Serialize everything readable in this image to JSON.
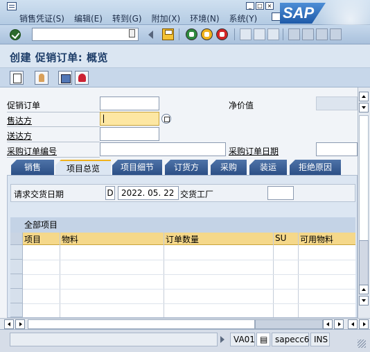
{
  "menu": {
    "items": [
      "销售凭证(S)",
      "编辑(E)",
      "转到(G)",
      "附加(X)",
      "环境(N)",
      "系统(Y)"
    ],
    "logo": "SAP"
  },
  "title": "创建 促销订单: 概览",
  "header_fields": {
    "promo_order_label": "促销订单",
    "net_value_label": "净价值",
    "sold_to_label": "售达方",
    "ship_to_label": "送达方",
    "po_number_label": "采购订单编号",
    "po_date_label": "采购订单日期"
  },
  "tabs": [
    {
      "label": "销售",
      "active": false
    },
    {
      "label": "项目总览",
      "active": true
    },
    {
      "label": "项目细节",
      "active": false
    },
    {
      "label": "订货方",
      "active": false
    },
    {
      "label": "采购",
      "active": false
    },
    {
      "label": "装运",
      "active": false
    },
    {
      "label": "拒绝原因",
      "active": false
    }
  ],
  "overview": {
    "req_delivery_date_label": "请求交货日期",
    "date_format": "D",
    "req_delivery_date": "2022. 05. 22",
    "plant_label": "交货工厂",
    "plant_value": ""
  },
  "table": {
    "title": "全部项目",
    "columns": [
      "项目",
      "物料",
      "订单数量",
      "SU",
      "可用物料"
    ],
    "rows": 4
  },
  "status": {
    "transaction": "VA01",
    "server": "sapecc6",
    "mode": "INS"
  },
  "colors": {
    "tab_active_accent": "#f0b21c",
    "required_field": "#fde7a3",
    "table_header": "#f5d88a"
  }
}
